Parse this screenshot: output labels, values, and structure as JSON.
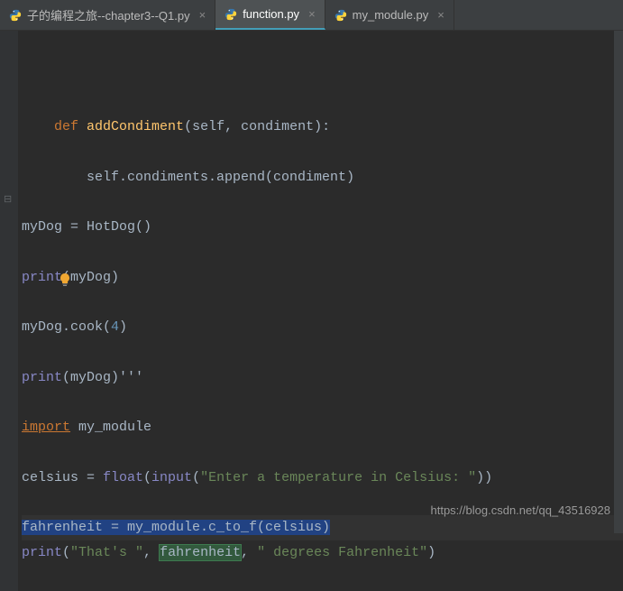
{
  "tabs": [
    {
      "label": "子的编程之旅--chapter3--Q1.py",
      "active": false
    },
    {
      "label": "function.py",
      "active": true
    },
    {
      "label": "my_module.py",
      "active": false
    }
  ],
  "code": {
    "l1_indent": "    ",
    "l1_def": "def ",
    "l1_name": "addCondiment",
    "l1_params": "(self, condiment):",
    "l2_indent": "        ",
    "l2_text": "self.condiments.append(condiment)",
    "l3_a": "myDog = HotDog()",
    "l4_print": "print",
    "l4_args": "(myDog)",
    "l5_a": "myDog.cook(",
    "l5_num": "4",
    "l5_b": ")",
    "l6_print": "print",
    "l6_args": "(myDog)'''",
    "l7_import": "import",
    "l7_mod": " my_module",
    "l8_a": "celsius = ",
    "l8_float": "float",
    "l8_b": "(",
    "l8_input": "input",
    "l8_c": "(",
    "l8_str": "\"Enter a temperature in Celsius: \"",
    "l8_d": "))",
    "l9_sel": "fahrenheit = my_module.c_to_f(celsius)",
    "l10_print": "print",
    "l10_a": "(",
    "l10_s1": "\"That's \"",
    "l10_b": ", ",
    "l10_hl": "fahrenheit",
    "l10_c": ", ",
    "l10_s2": "\" degrees Fahrenheit\"",
    "l10_d": ")"
  },
  "watermark": "https://blog.csdn.net/qq_43516928"
}
